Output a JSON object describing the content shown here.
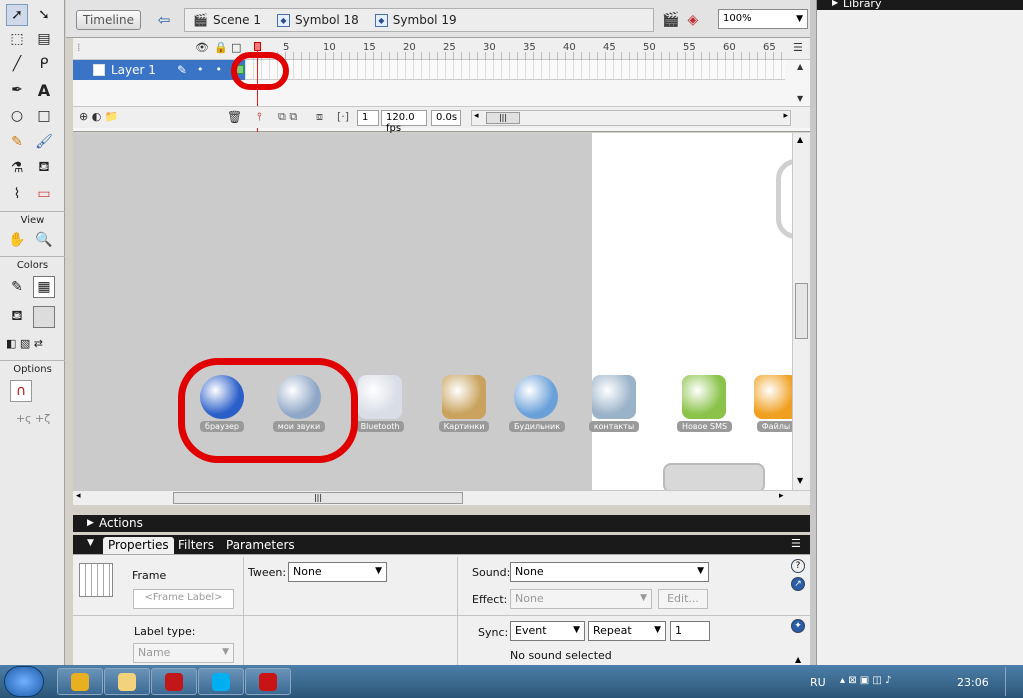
{
  "tools": {
    "view_label": "View",
    "colors_label": "Colors",
    "options_label": "Options",
    "text_tool_glyph": "A"
  },
  "topbar": {
    "timeline_button": "Timeline",
    "breadcrumbs": [
      "Scene 1",
      "Symbol 18",
      "Symbol 19"
    ],
    "zoom": "100%"
  },
  "timeline": {
    "frame_numbers": [
      "5",
      "10",
      "15",
      "20",
      "25",
      "30",
      "35",
      "40",
      "45",
      "50",
      "55",
      "60",
      "65"
    ],
    "layer_name": "Layer 1",
    "current_frame": "1",
    "fps": "120.0 fps",
    "elapsed": "0.0s"
  },
  "stage": {
    "app_icons": [
      {
        "label": "браузер",
        "icon": "globe-icon",
        "color": "#2a5ec9"
      },
      {
        "label": "мои звуки",
        "icon": "speaker-icon",
        "color": "#8fa7c7"
      },
      {
        "label": "Bluetooth",
        "icon": "bluetooth-icon",
        "color": "#d9dde6"
      },
      {
        "label": "Картинки",
        "icon": "picture-icon",
        "color": "#c9a35d"
      },
      {
        "label": "Будильник",
        "icon": "alarm-clock-icon",
        "color": "#6aa0d9"
      },
      {
        "label": "контакты",
        "icon": "contacts-icon",
        "color": "#9bb3c9"
      },
      {
        "label": "Новое SMS",
        "icon": "sms-icon",
        "color": "#8bc34a"
      },
      {
        "label": "Файлы",
        "icon": "folder-icon",
        "color": "#f0a020"
      }
    ]
  },
  "panels": {
    "actions_label": "Actions",
    "library_label": "Library"
  },
  "properties": {
    "tabs": [
      "Properties",
      "Filters",
      "Parameters"
    ],
    "frame_label": "Frame",
    "frame_label_placeholder": "<Frame Label>",
    "label_type_label": "Label type:",
    "label_type_value": "Name",
    "tween_label": "Tween:",
    "tween_value": "None",
    "sound_label": "Sound:",
    "sound_value": "None",
    "effect_label": "Effect:",
    "effect_value": "None",
    "edit_button": "Edit...",
    "sync_label": "Sync:",
    "sync_value": "Event",
    "repeat_value": "Repeat",
    "repeat_count": "1",
    "sound_status": "No sound selected"
  },
  "taskbar": {
    "apps": [
      {
        "name": "chrome",
        "color": "#e8b020"
      },
      {
        "name": "explorer",
        "color": "#f2d27a"
      },
      {
        "name": "filezilla",
        "color": "#c01818"
      },
      {
        "name": "skype",
        "color": "#00aff0"
      },
      {
        "name": "flash",
        "color": "#c81414"
      }
    ],
    "language": "RU",
    "clock": "23:06"
  },
  "colors": {
    "accent": "#3a74c7",
    "annotation_red": "#e00000"
  }
}
